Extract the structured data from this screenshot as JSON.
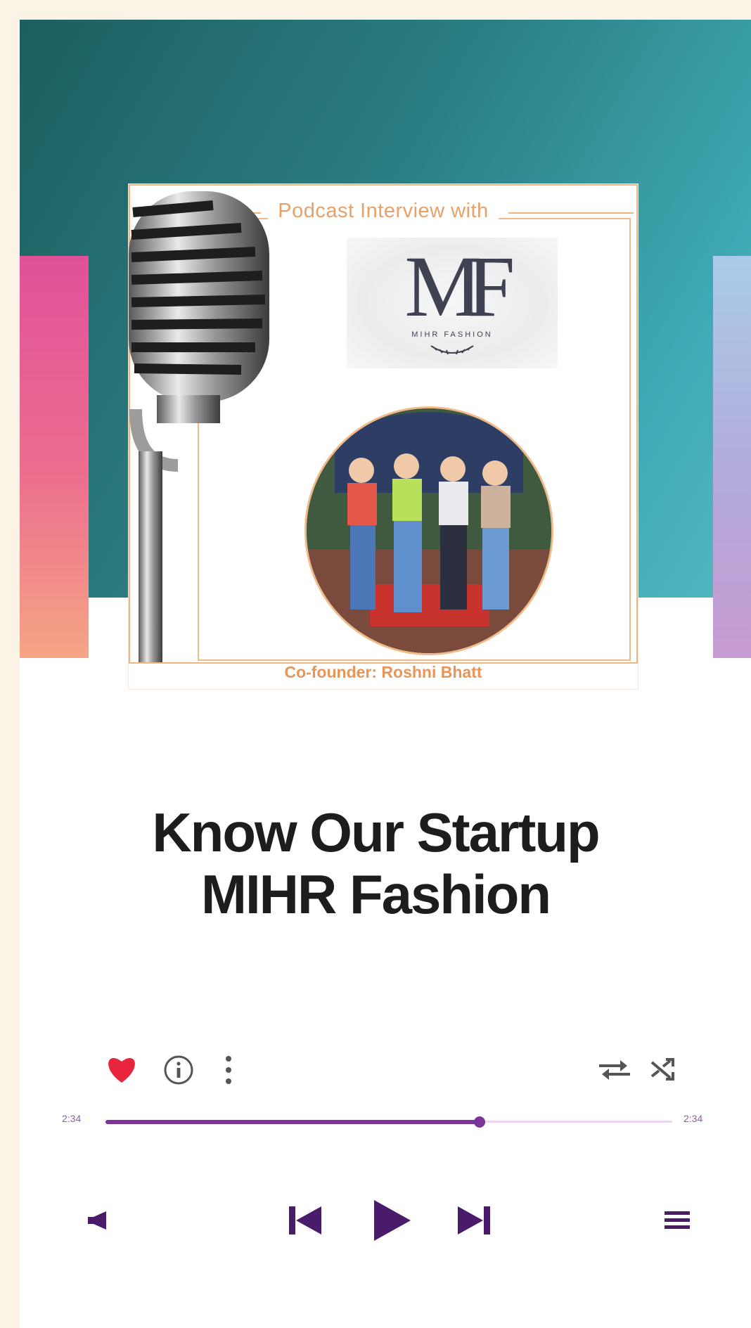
{
  "cover": {
    "headline": "Podcast Interview with",
    "logo_mark": "MF",
    "logo_subtitle": "MIHR FASHION",
    "caption": "Co-founder: Roshni Bhatt"
  },
  "title": {
    "line1": "Know Our Startup",
    "line2": "MIHR Fashion"
  },
  "player": {
    "elapsed": "2:34",
    "duration": "2:34",
    "progress": 0.66,
    "liked": true
  },
  "colors": {
    "accent": "#7a3597",
    "heart": "#e8253a",
    "track_bg": "#ead7ef",
    "cover_orange": "#e8955a"
  },
  "icons": {
    "like": "heart-icon",
    "info": "info-icon",
    "more": "more-vertical-icon",
    "repeat": "repeat-icon",
    "shuffle": "shuffle-icon",
    "volume": "volume-icon",
    "previous": "skip-previous-icon",
    "play": "play-icon",
    "next": "skip-next-icon",
    "queue": "queue-menu-icon"
  }
}
